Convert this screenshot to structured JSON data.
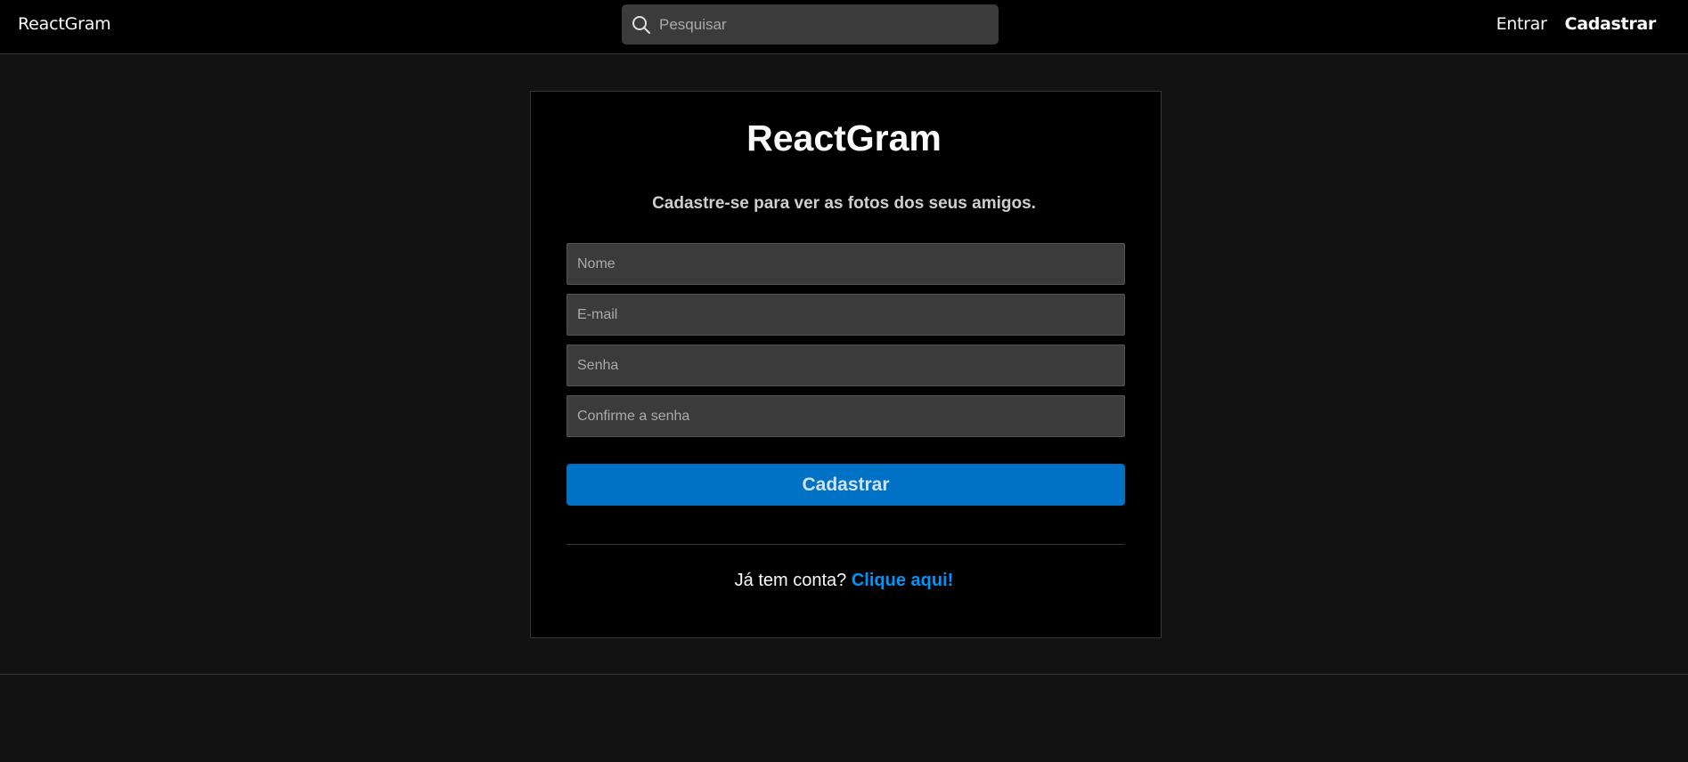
{
  "navbar": {
    "brand": "ReactGram",
    "search_placeholder": "Pesquisar",
    "links": {
      "login": "Entrar",
      "register": "Cadastrar"
    }
  },
  "register": {
    "title": "ReactGram",
    "subtitle": "Cadastre-se para ver as fotos dos seus amigos.",
    "fields": {
      "name_placeholder": "Nome",
      "email_placeholder": "E-mail",
      "password_placeholder": "Senha",
      "confirm_placeholder": "Confirme a senha"
    },
    "submit_label": "Cadastrar",
    "have_account_text": "Já tem conta?",
    "login_link": "Clique aqui!"
  },
  "colors": {
    "background": "#121212",
    "navbar": "#000000",
    "card": "#000000",
    "accent_button": "#0072c6",
    "link": "#0095f6"
  }
}
